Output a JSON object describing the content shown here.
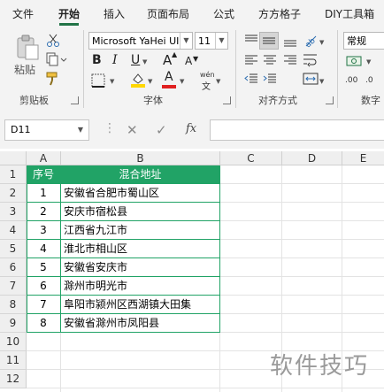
{
  "tabs": [
    {
      "label": "文件"
    },
    {
      "label": "开始"
    },
    {
      "label": "插入"
    },
    {
      "label": "页面布局"
    },
    {
      "label": "公式"
    },
    {
      "label": "方方格子"
    },
    {
      "label": "DIY工具箱"
    }
  ],
  "ribbon": {
    "clipboard": {
      "paste_label": "粘贴",
      "group_label": "剪贴板"
    },
    "font": {
      "font_name": "Microsoft YaHei UI",
      "font_size": "11",
      "bold": "B",
      "italic": "I",
      "underline": "U",
      "grow": "A",
      "shrink": "A",
      "font_color_glyph": "A",
      "phonetic": "wén",
      "group_label": "字体"
    },
    "alignment": {
      "group_label": "对齐方式"
    },
    "number": {
      "format": "常规",
      "group_label": "数字"
    },
    "colors": {
      "fill": "#ffd700",
      "font_color": "#e02020",
      "accent": "#217346"
    }
  },
  "formula_bar": {
    "name_box": "D11",
    "fx_label": "fx",
    "value": ""
  },
  "columns": [
    "A",
    "B",
    "C",
    "D",
    "E"
  ],
  "rows": [
    "1",
    "2",
    "3",
    "4",
    "5",
    "6",
    "7",
    "8",
    "9",
    "10",
    "11",
    "12"
  ],
  "table": {
    "header": {
      "a": "序号",
      "b": "混合地址"
    },
    "rows": [
      {
        "a": "1",
        "b": "安徽省合肥市蜀山区"
      },
      {
        "a": "2",
        "b": "安庆市宿松县"
      },
      {
        "a": "3",
        "b": "江西省九江市"
      },
      {
        "a": "4",
        "b": "淮北市相山区"
      },
      {
        "a": "5",
        "b": "安徽省安庆市"
      },
      {
        "a": "6",
        "b": "滁州市明光市"
      },
      {
        "a": "7",
        "b": "阜阳市颍州区西湖镇大田集"
      },
      {
        "a": "8",
        "b": "安徽省滁州市凤阳县"
      }
    ],
    "header_color": "#21a366"
  },
  "watermark": "软件技巧"
}
